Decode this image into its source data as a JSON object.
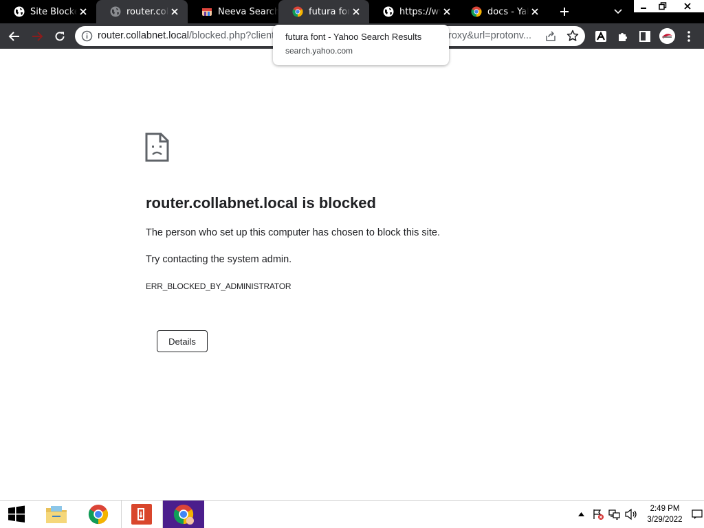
{
  "browser": {
    "tabs": [
      {
        "title": "Site Blocked",
        "icon": "globe-icon",
        "active": false
      },
      {
        "title": "router.collabnet.local",
        "icon": "globe-grey-icon",
        "active": false
      },
      {
        "title": "Neeva Search",
        "icon": "neeva-icon",
        "active": false
      },
      {
        "title": "futura font - Yahoo Search Results",
        "icon": "chrome-icon",
        "active": true
      },
      {
        "title": "https://www.",
        "icon": "globe-icon",
        "active": false
      },
      {
        "title": "docs - Yahoo Search",
        "icon": "chrome-icon",
        "active": false
      }
    ],
    "hover_card": {
      "title": "futura font - Yahoo Search Results",
      "domain": "search.yahoo.com"
    },
    "omnibox": {
      "host": "router.collabnet.local",
      "path": "/blocked.php?clienta",
      "tail": "roxy&url=protonv..."
    }
  },
  "page": {
    "heading": "router.collabnet.local is blocked",
    "message": "The person who set up this computer has chosen to block this site.",
    "suggestion": "Try contacting the system admin.",
    "error_code": "ERR_BLOCKED_BY_ADMINISTRATOR",
    "details_label": "Details"
  },
  "taskbar": {
    "time": "2:49 PM",
    "date": "3/29/2022"
  },
  "colors": {
    "tabstrip": "#000000",
    "active_tab": "#35363a",
    "toolbar": "#35363a",
    "text": "#202124",
    "taskbar_active": "#4b1e8c"
  }
}
